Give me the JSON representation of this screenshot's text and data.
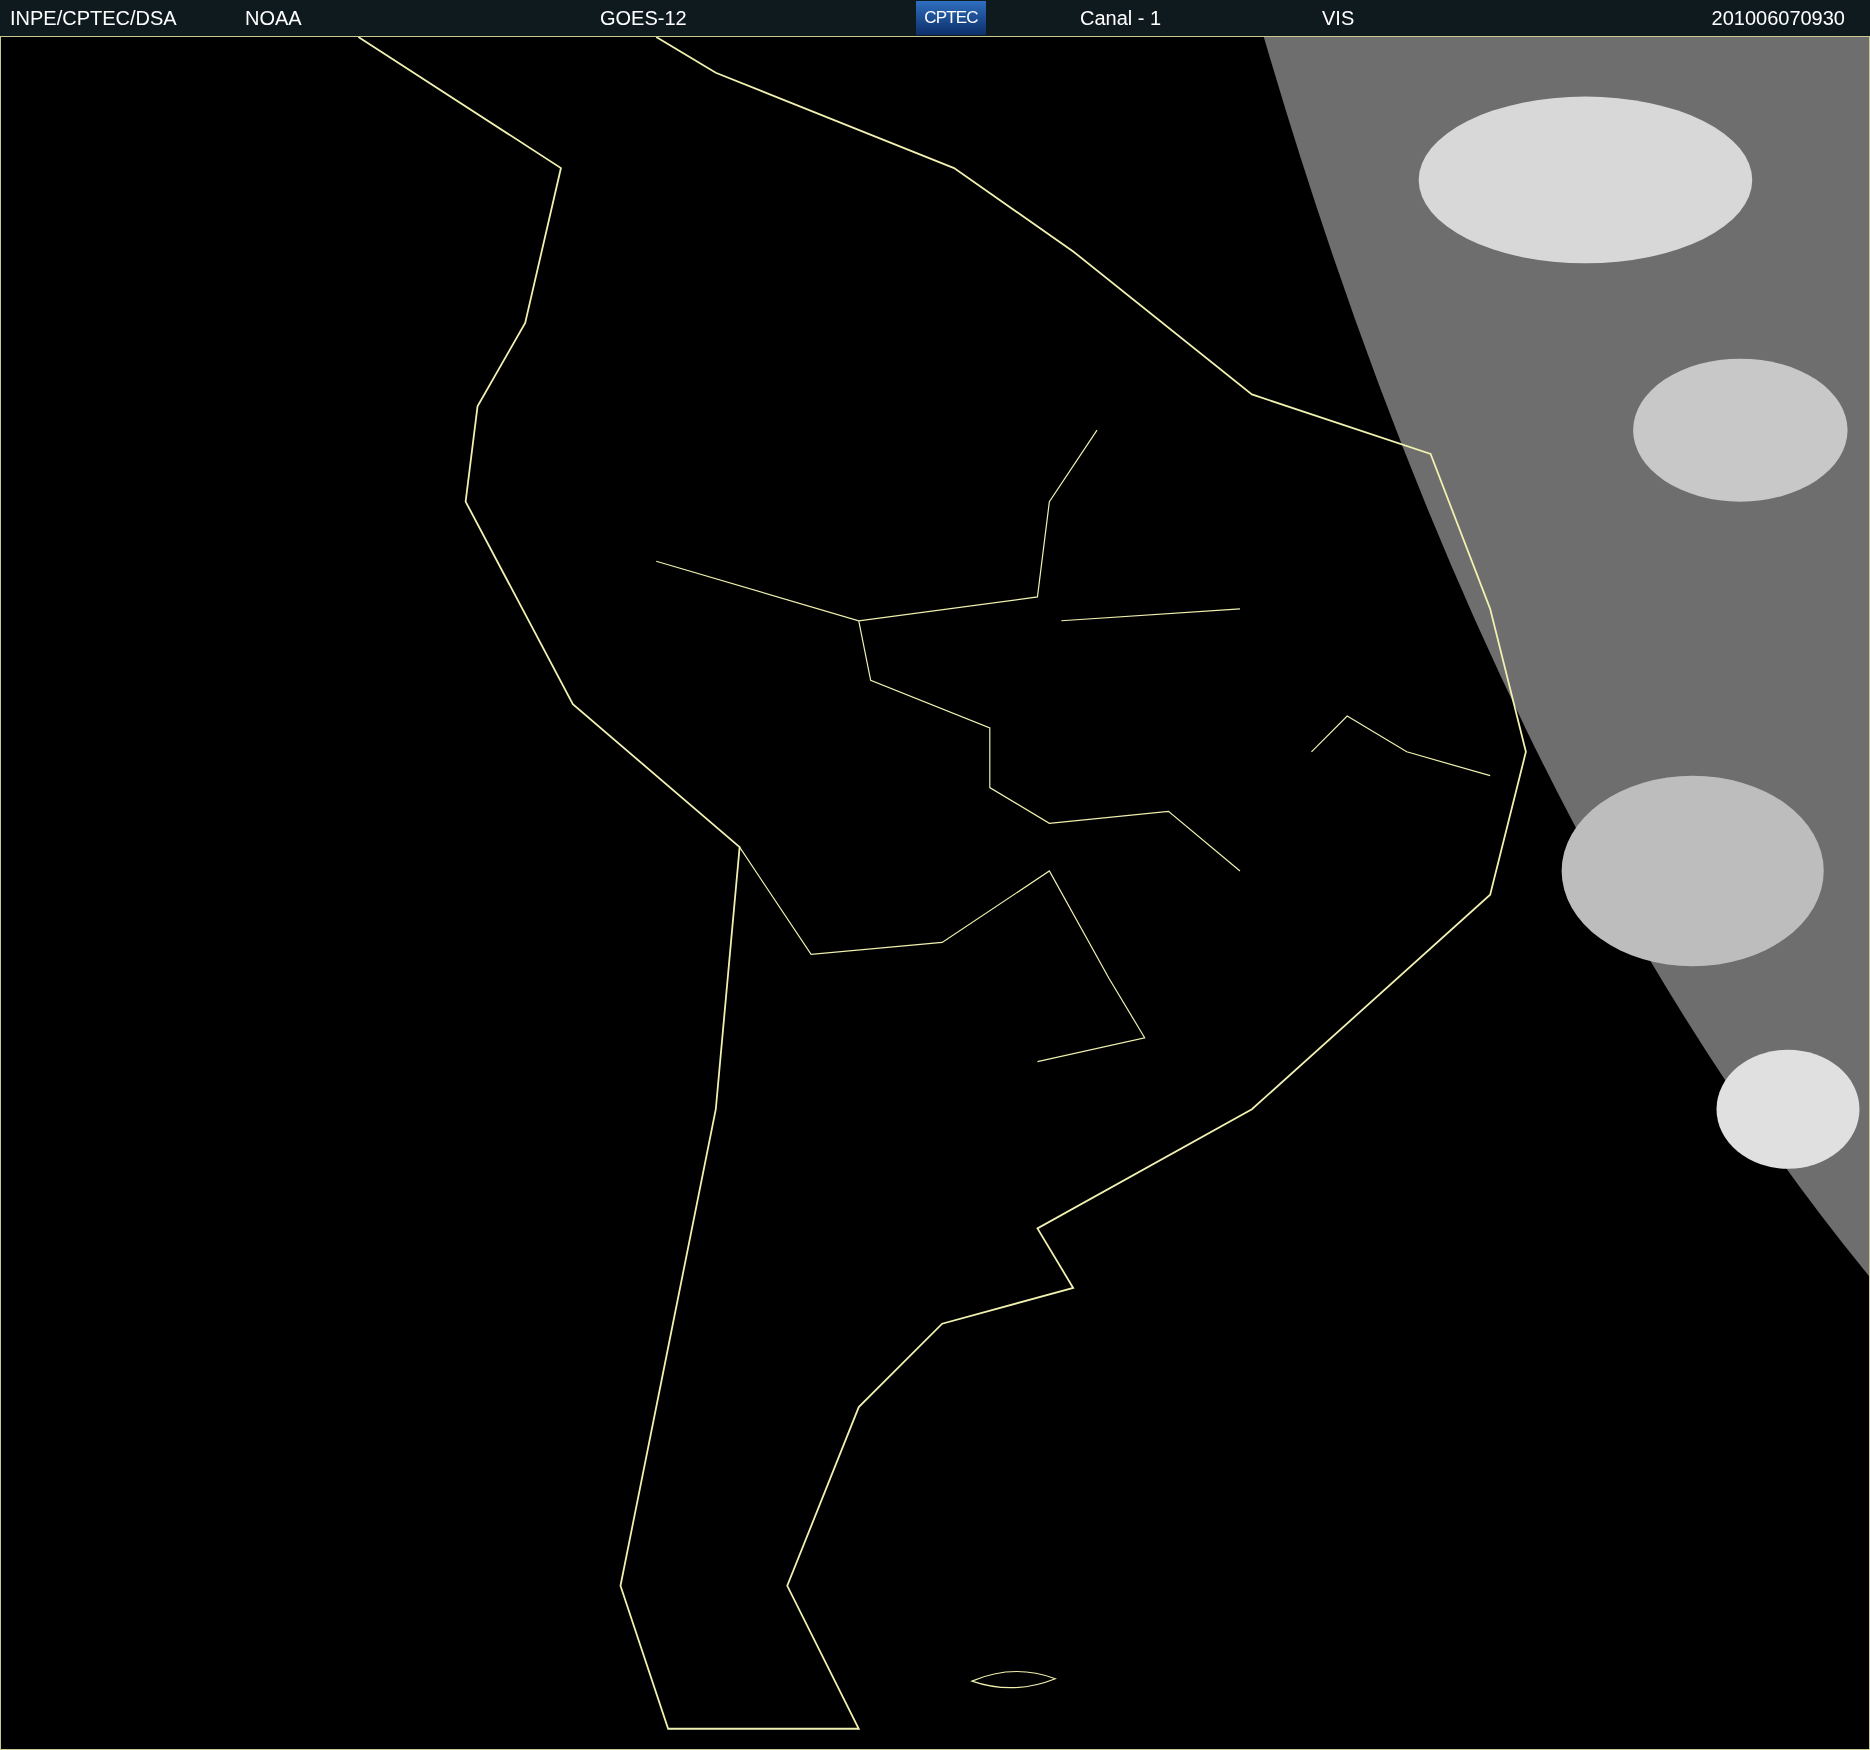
{
  "header": {
    "items": [
      {
        "kind": "text",
        "text": "INPE/CPTEC/DSA"
      },
      {
        "kind": "text",
        "text": "NOAA"
      },
      {
        "kind": "text",
        "text": "GOES-12"
      },
      {
        "kind": "logo",
        "text": "CPTEC"
      },
      {
        "kind": "text",
        "text": "Canal - 1"
      },
      {
        "kind": "text",
        "text": "VIS"
      },
      {
        "kind": "text",
        "text": "201006070930"
      }
    ]
  }
}
